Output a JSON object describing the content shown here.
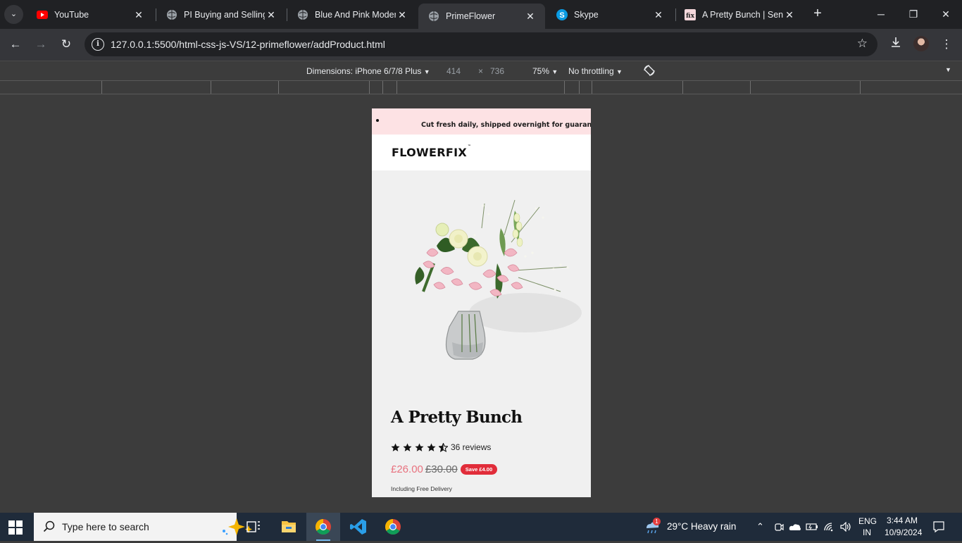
{
  "tabs": [
    {
      "title": "YouTube",
      "icon": "youtube-icon"
    },
    {
      "title": "PI Buying and Selling",
      "icon": "globe-icon"
    },
    {
      "title": "Blue And Pink Moder",
      "icon": "globe-icon"
    },
    {
      "title": "PrimeFlower",
      "icon": "globe-icon",
      "active": true
    },
    {
      "title": "Skype",
      "icon": "skype-icon"
    },
    {
      "title": "A Pretty Bunch | Send",
      "icon": "flowerfix-icon"
    }
  ],
  "toolbar": {
    "url": "127.0.0.1:5500/html-css-js-VS/12-primeflower/addProduct.html"
  },
  "devtools": {
    "dimensions_label": "Dimensions: iPhone 6/7/8 Plus",
    "width": "414",
    "times": "×",
    "height": "736",
    "zoom": "75%",
    "throttling": "No throttling"
  },
  "page": {
    "announcement": "Cut fresh daily, shipped overnight for guarante",
    "logo": "FLOWERFIX",
    "logo_tm": "™",
    "product": {
      "title": "A Pretty Bunch",
      "rating": 4.5,
      "reviews": "36 reviews",
      "price": "£26.00",
      "old_price": "£30.00",
      "save_label": "Save £4.00",
      "delivery": "Including Free Delivery"
    }
  },
  "taskbar": {
    "search_placeholder": "Type here to search",
    "weather_badge": "1",
    "weather": "29°C  Heavy rain",
    "lang_top": "ENG",
    "lang_bottom": "IN",
    "time": "3:44 AM",
    "date": "10/9/2024"
  },
  "colors": {
    "announce_bg": "#fde2e4",
    "price": "#e8727f",
    "save_badge": "#e12d3a",
    "page_bg": "#f0f0f0"
  }
}
